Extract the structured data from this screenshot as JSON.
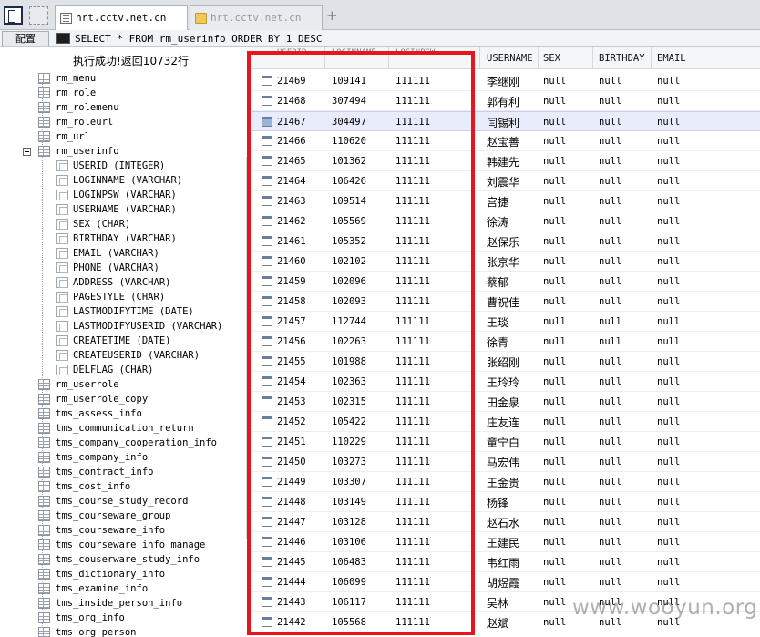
{
  "tabs": [
    {
      "label": "hrt.cctv.net.cn",
      "active": true
    },
    {
      "label": "hrt.cctv.net.cn",
      "active": false
    }
  ],
  "toolbar": {
    "config_label": "配置",
    "sql": "SELECT * FROM rm_userinfo ORDER BY 1 DESC"
  },
  "status": "执行成功!返回10732行",
  "tree": {
    "tables_before": [
      "rm_menu",
      "rm_role",
      "rm_rolemenu",
      "rm_roleurl",
      "rm_url"
    ],
    "expanded_table": "rm_userinfo",
    "columns": [
      "USERID (INTEGER)",
      "LOGINNAME (VARCHAR)",
      "LOGINPSW (VARCHAR)",
      "USERNAME (VARCHAR)",
      "SEX (CHAR)",
      "BIRTHDAY (VARCHAR)",
      "EMAIL (VARCHAR)",
      "PHONE (VARCHAR)",
      "ADDRESS (VARCHAR)",
      "PAGESTYLE (CHAR)",
      "LASTMODIFYTIME (DATE)",
      "LASTMODIFYUSERID (VARCHAR)",
      "CREATETIME (DATE)",
      "CREATEUSERID (VARCHAR)",
      "DELFLAG (CHAR)"
    ],
    "tables_after": [
      "rm_userrole",
      "rm_userrole_copy",
      "tms_assess_info",
      "tms_communication_return",
      "tms_company_cooperation_info",
      "tms_company_info",
      "tms_contract_info",
      "tms_cost_info",
      "tms_course_study_record",
      "tms_courseware_group",
      "tms_courseware_info",
      "tms_courseware_info_manage",
      "tms_couserware_study_info",
      "tms_dictionary_info",
      "tms_examine_info",
      "tms_inside_person_info",
      "tms_org_info",
      "tms_org_person"
    ]
  },
  "grid": {
    "columns": [
      "USERID",
      "LOGINNAME",
      "LOGINPSW",
      "USERNAME",
      "SEX",
      "BIRTHDAY",
      "EMAIL"
    ],
    "selected_row": 2,
    "rows": [
      [
        "21469",
        "109141",
        "111111",
        "李继刚",
        "null",
        "null",
        "null"
      ],
      [
        "21468",
        "307494",
        "111111",
        "郭有利",
        "null",
        "null",
        "null"
      ],
      [
        "21467",
        "304497",
        "111111",
        "闫锡利",
        "null",
        "null",
        "null"
      ],
      [
        "21466",
        "110620",
        "111111",
        "赵宝善",
        "null",
        "null",
        "null"
      ],
      [
        "21465",
        "101362",
        "111111",
        "韩建先",
        "null",
        "null",
        "null"
      ],
      [
        "21464",
        "106426",
        "111111",
        "刘震华",
        "null",
        "null",
        "null"
      ],
      [
        "21463",
        "109514",
        "111111",
        "宫捷",
        "null",
        "null",
        "null"
      ],
      [
        "21462",
        "105569",
        "111111",
        "徐涛",
        "null",
        "null",
        "null"
      ],
      [
        "21461",
        "105352",
        "111111",
        "赵保乐",
        "null",
        "null",
        "null"
      ],
      [
        "21460",
        "102102",
        "111111",
        "张京华",
        "null",
        "null",
        "null"
      ],
      [
        "21459",
        "102096",
        "111111",
        "蔡郁",
        "null",
        "null",
        "null"
      ],
      [
        "21458",
        "102093",
        "111111",
        "曹祝佳",
        "null",
        "null",
        "null"
      ],
      [
        "21457",
        "112744",
        "111111",
        "王琰",
        "null",
        "null",
        "null"
      ],
      [
        "21456",
        "102263",
        "111111",
        "徐青",
        "null",
        "null",
        "null"
      ],
      [
        "21455",
        "101988",
        "111111",
        "张绍刚",
        "null",
        "null",
        "null"
      ],
      [
        "21454",
        "102363",
        "111111",
        "王玲玲",
        "null",
        "null",
        "null"
      ],
      [
        "21453",
        "102315",
        "111111",
        "田金泉",
        "null",
        "null",
        "null"
      ],
      [
        "21452",
        "105422",
        "111111",
        "庄友连",
        "null",
        "null",
        "null"
      ],
      [
        "21451",
        "110229",
        "111111",
        "童宁白",
        "null",
        "null",
        "null"
      ],
      [
        "21450",
        "103273",
        "111111",
        "马宏伟",
        "null",
        "null",
        "null"
      ],
      [
        "21449",
        "103307",
        "111111",
        "王金贵",
        "null",
        "null",
        "null"
      ],
      [
        "21448",
        "103149",
        "111111",
        "杨锋",
        "null",
        "null",
        "null"
      ],
      [
        "21447",
        "103128",
        "111111",
        "赵石水",
        "null",
        "null",
        "null"
      ],
      [
        "21446",
        "103106",
        "111111",
        "王建民",
        "null",
        "null",
        "null"
      ],
      [
        "21445",
        "106483",
        "111111",
        "韦红雨",
        "null",
        "null",
        "null"
      ],
      [
        "21444",
        "106099",
        "111111",
        "胡煜霞",
        "null",
        "null",
        "null"
      ],
      [
        "21443",
        "106117",
        "111111",
        "吴林",
        "null",
        "null",
        "null"
      ],
      [
        "21442",
        "105568",
        "111111",
        "赵斌",
        "null",
        "null",
        "null"
      ]
    ]
  },
  "watermark": "www.wooyun.org",
  "colors": {
    "annotation": "#e8141e",
    "selected_row": "#e8ecfb"
  }
}
